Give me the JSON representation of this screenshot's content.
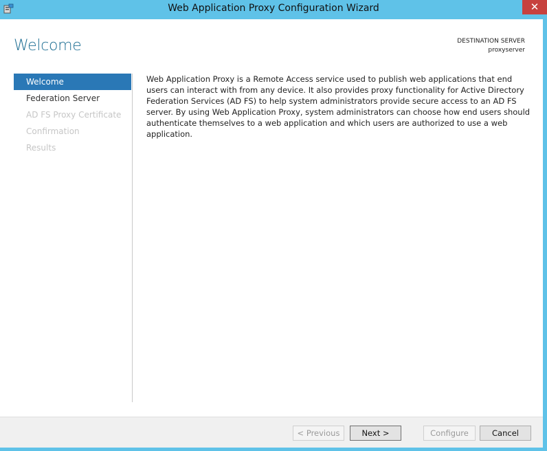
{
  "window": {
    "title": "Web Application Proxy Configuration Wizard",
    "close_label": "✕",
    "icon": "server-wizard-icon",
    "accent": "#5fc2e8"
  },
  "header": {
    "heading": "Welcome",
    "destination_label": "DESTINATION SERVER",
    "destination_value": "proxyserver"
  },
  "nav": {
    "items": [
      {
        "label": "Welcome",
        "state": "selected"
      },
      {
        "label": "Federation Server",
        "state": "enabled"
      },
      {
        "label": "AD FS Proxy Certificate",
        "state": "disabled"
      },
      {
        "label": "Confirmation",
        "state": "disabled"
      },
      {
        "label": "Results",
        "state": "disabled"
      }
    ],
    "selected_color": "#2a78b6"
  },
  "content": {
    "description": "Web Application Proxy is a Remote Access service used to publish web applications that end users can interact with from any device. It also provides proxy functionality for Active Directory Federation Services (AD FS) to help system administrators provide secure access to an AD FS server. By using Web Application Proxy, system administrators can choose how end users should authenticate themselves to a web application and which users are authorized to use a web application."
  },
  "footer": {
    "previous_label": "< Previous",
    "next_label": "Next >",
    "configure_label": "Configure",
    "cancel_label": "Cancel"
  }
}
